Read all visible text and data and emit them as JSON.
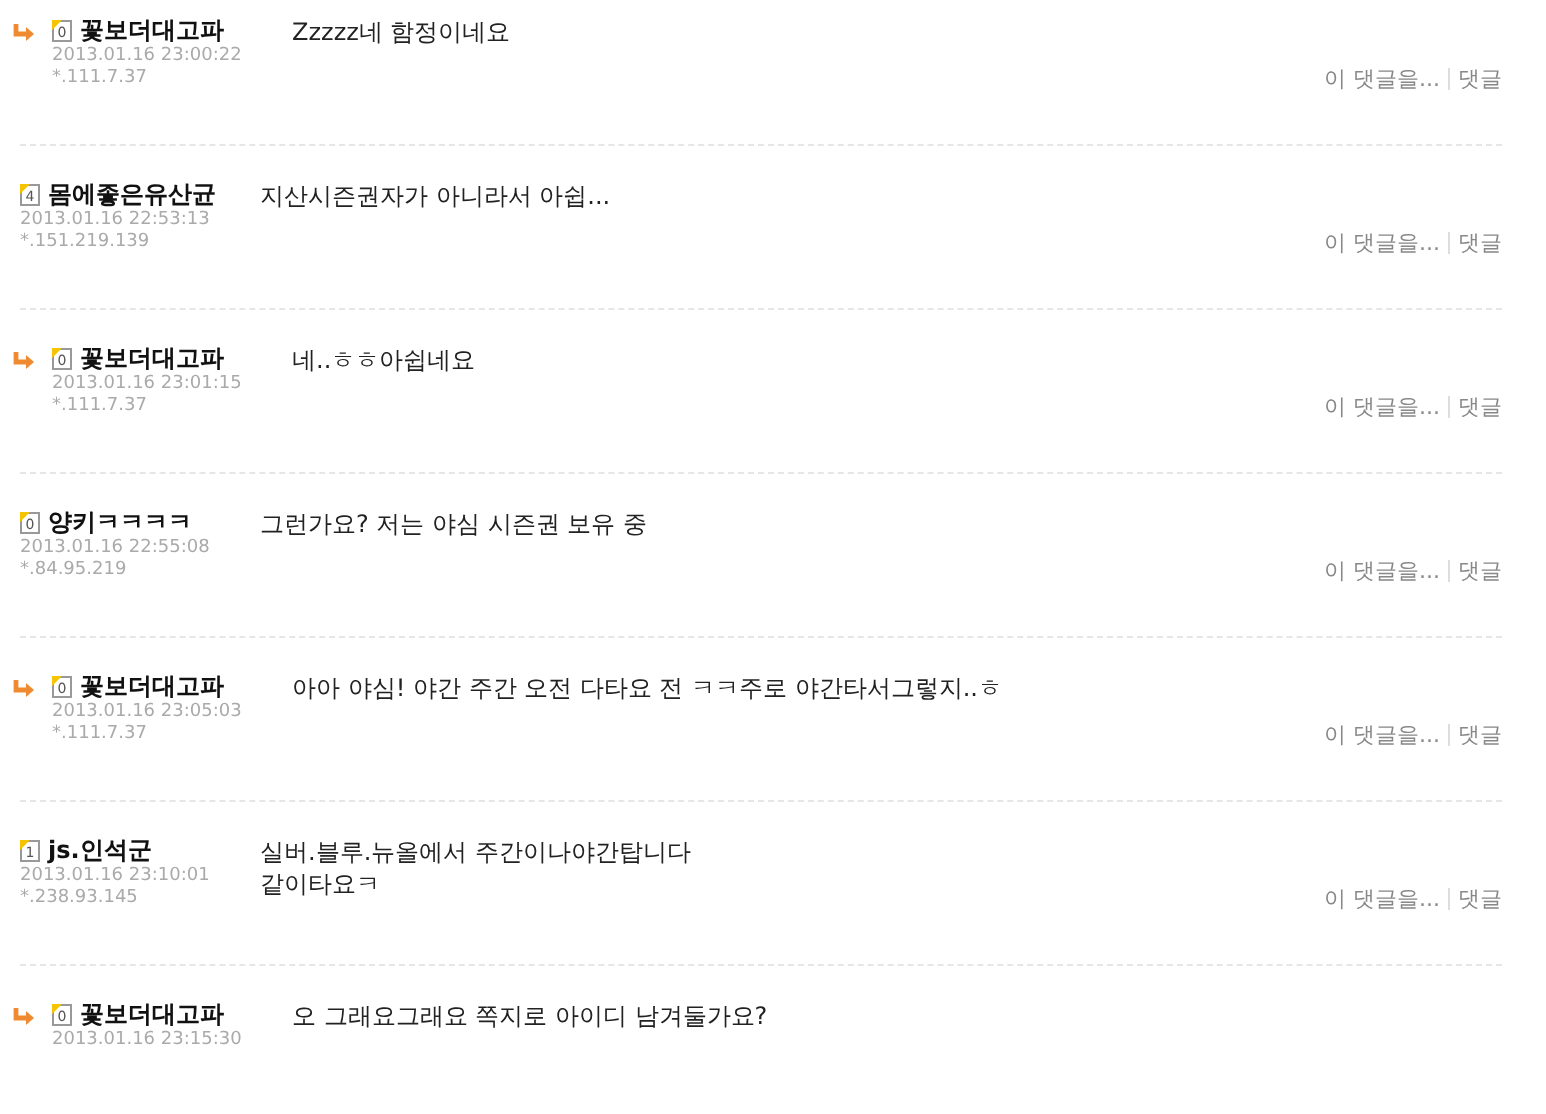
{
  "comments": [
    {
      "reply": true,
      "level": "0",
      "name": "꽃보더대고파",
      "date": "2013.01.16 23:00:22",
      "ip": "*.111.7.37",
      "body": [
        "Zzzzz네 함정이네요"
      ],
      "actions": [
        "이 댓글을...",
        "댓글"
      ]
    },
    {
      "reply": false,
      "level": "4",
      "name": "몸에좋은유산균",
      "date": "2013.01.16 22:53:13",
      "ip": "*.151.219.139",
      "body": [
        "지산시즌권자가 아니라서 아쉽..."
      ],
      "actions": [
        "이 댓글을...",
        "댓글"
      ]
    },
    {
      "reply": true,
      "level": "0",
      "name": "꽃보더대고파",
      "date": "2013.01.16 23:01:15",
      "ip": "*.111.7.37",
      "body": [
        "네..ㅎㅎ아쉽네요"
      ],
      "actions": [
        "이 댓글을...",
        "댓글"
      ]
    },
    {
      "reply": false,
      "level": "0",
      "name": "양키ㅋㅋㅋㅋ",
      "date": "2013.01.16 22:55:08",
      "ip": "*.84.95.219",
      "body": [
        "그런가요? 저는 야심 시즌권 보유 중"
      ],
      "actions": [
        "이 댓글을...",
        "댓글"
      ]
    },
    {
      "reply": true,
      "level": "0",
      "name": "꽃보더대고파",
      "date": "2013.01.16 23:05:03",
      "ip": "*.111.7.37",
      "body": [
        "아아 야심! 야간 주간 오전 다타요 전 ㅋㅋ주로 야간타서그렇지..ㅎ"
      ],
      "actions": [
        "이 댓글을...",
        "댓글"
      ]
    },
    {
      "reply": false,
      "level": "1",
      "name": "js.인석군",
      "date": "2013.01.16 23:10:01",
      "ip": "*.238.93.145",
      "body": [
        "실버.블루.뉴올에서 주간이나야간탑니다",
        "같이타요ㅋ"
      ],
      "actions": [
        "이 댓글을...",
        "댓글"
      ]
    },
    {
      "reply": true,
      "level": "0",
      "name": "꽃보더대고파",
      "date": "2013.01.16 23:15:30",
      "body": [
        "오 그래요그래요 쪽지로 아이디 남겨둘가요?"
      ]
    }
  ]
}
